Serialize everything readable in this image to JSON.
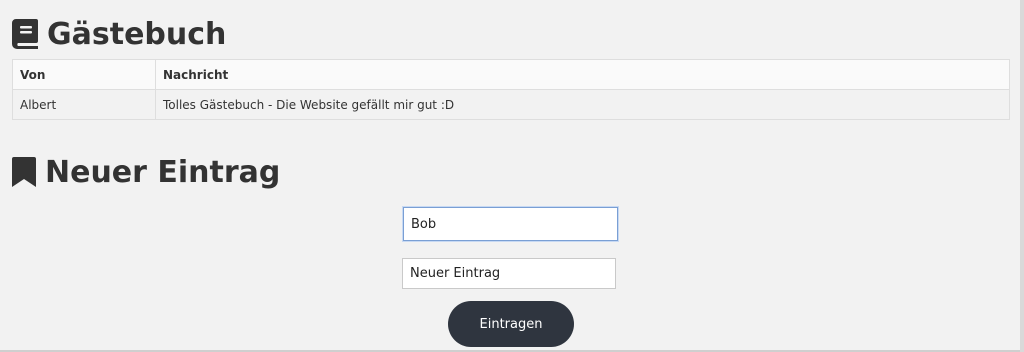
{
  "guestbook": {
    "title": "Gästebuch",
    "icon": "book-icon",
    "table": {
      "headers": [
        "Von",
        "Nachricht"
      ],
      "rows": [
        [
          "Albert",
          "Tolles Gästebuch - Die Website gefällt mir gut :D"
        ]
      ]
    }
  },
  "new_entry": {
    "title": "Neuer Eintrag",
    "icon": "bookmark-icon",
    "name_input": {
      "value": "Bob"
    },
    "message_input": {
      "value": "Neuer Eintrag"
    },
    "submit_label": "Eintragen"
  },
  "colors": {
    "background": "#f2f2f2",
    "text": "#333333",
    "button": "#2f353f",
    "focus_border": "#7a9fd4"
  }
}
